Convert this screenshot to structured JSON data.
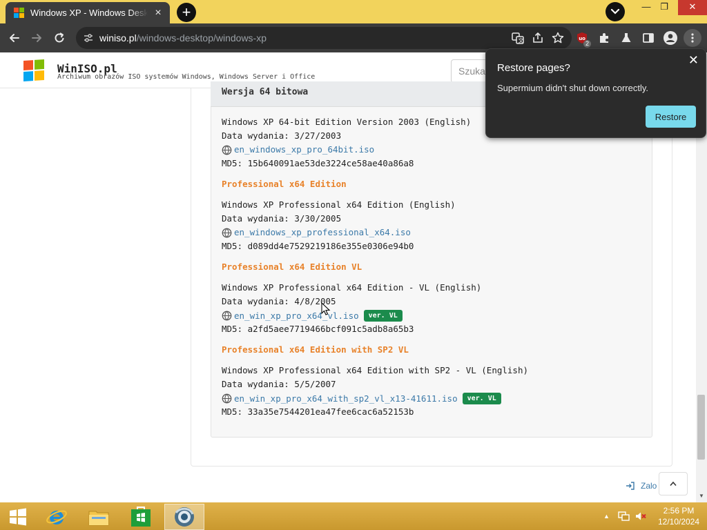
{
  "browser": {
    "tab_title": "Windows XP - Windows Desktop",
    "url_host": "winiso.pl",
    "url_path": "/windows-desktop/windows-xp",
    "extension_badge": "2"
  },
  "site": {
    "title": "WinISO.pl",
    "subtitle": "Archiwum obrazów ISO systemów Windows, Windows Server i Office",
    "search_placeholder": "Szuka"
  },
  "section_header": "Wersja 64 bitowa",
  "entries": [
    {
      "heading": "",
      "name": "Windows XP 64-bit Edition Version 2003 (English)",
      "date": "Data wydania: 3/27/2003",
      "file": "en_windows_xp_pro_64bit.iso",
      "badge": "",
      "md5": "MD5: 15b640091ae53de3224ce58ae40a86a8"
    },
    {
      "heading": "Professional x64 Edition",
      "name": "Windows XP Professional x64 Edition (English)",
      "date": "Data wydania: 3/30/2005",
      "file": "en_windows_xp_professional_x64.iso",
      "badge": "",
      "md5": "MD5: d089dd4e7529219186e355e0306e94b0"
    },
    {
      "heading": "Professional x64 Edition VL",
      "name": "Windows XP Professional x64 Edition - VL (English)",
      "date": "Data wydania: 4/8/2005",
      "file": "en_win_xp_pro_x64_vl.iso",
      "badge": "ver. VL",
      "md5": "MD5: a2fd5aee7719466bcf091c5adb8a65b3"
    },
    {
      "heading": "Professional x64 Edition with SP2 VL",
      "name": "Windows XP Professional x64 Edition with SP2 - VL (English)",
      "date": "Data wydania: 5/5/2007",
      "file": "en_win_xp_pro_x64_with_sp2_vl_x13-41611.iso",
      "badge": "ver. VL",
      "md5": "MD5: 33a35e7544201ea47fee6cac6a52153b"
    }
  ],
  "footer_link": "Zalo",
  "popup": {
    "title": "Restore pages?",
    "message": "Supermium didn't shut down correctly.",
    "button": "Restore"
  },
  "taskbar": {
    "time": "2:56 PM",
    "date": "12/10/2024"
  },
  "colors": {
    "tabstrip": "#f2d35c",
    "section_heading": "#e8822a",
    "link": "#3b79a8",
    "vl_badge": "#1b8b4c",
    "restore_button": "#78d9ec",
    "taskbar": "#d9a83d"
  },
  "icons": [
    "windows-logo-icon",
    "globe-icon",
    "translate-icon",
    "share-icon",
    "star-icon",
    "extensions-icon",
    "profile-icon",
    "menu-icon"
  ]
}
